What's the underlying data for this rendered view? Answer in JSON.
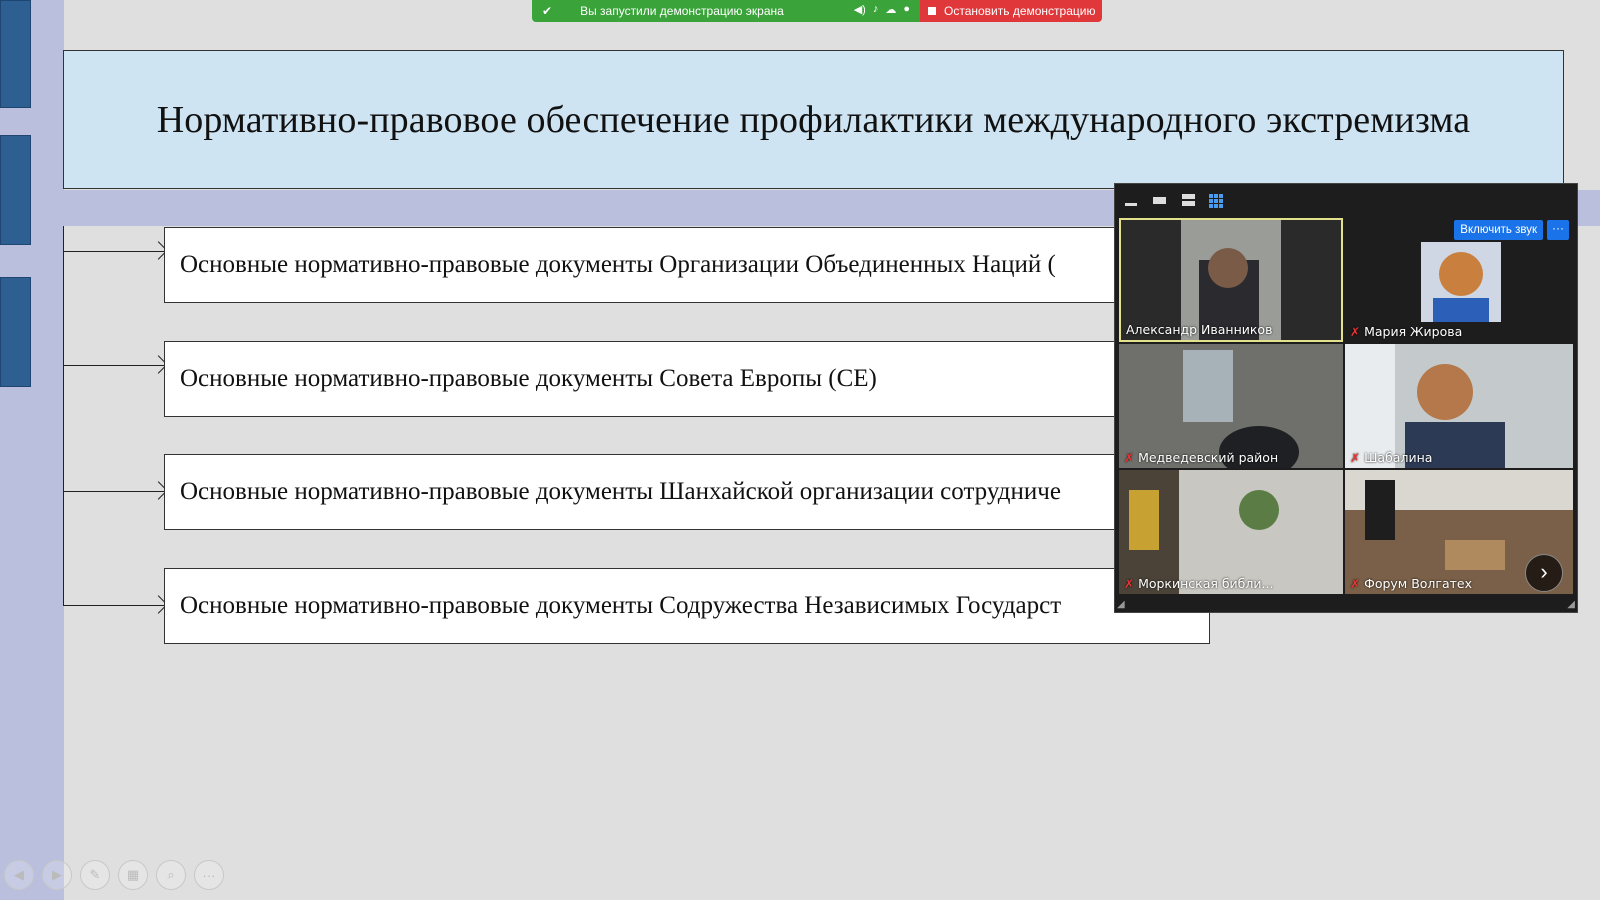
{
  "share_banner": {
    "status_text": "Вы запустили демонстрацию экрана",
    "stop_label": "Остановить демонстрацию"
  },
  "slide": {
    "title": "Нормативно-правовое обеспечение профилактики международного экстремизма",
    "items": [
      "Основные нормативно-правовые документы Организации Объединенных Наций (",
      "Основные нормативно-правовые документы Совета Европы (СЕ)",
      "Основные нормативно-правовые документы Шанхайской организации сотрудниче",
      "Основные нормативно-правовые документы Содружества Независимых Государст"
    ]
  },
  "video_panel": {
    "unmute_label": "Включить звук",
    "more_label": "···",
    "participants": [
      {
        "name": "Александр Иванников",
        "muted": false,
        "active": true
      },
      {
        "name": "Мария Жирова",
        "muted": true,
        "active": false
      },
      {
        "name": "Медведевский район",
        "muted": true,
        "active": false
      },
      {
        "name": "Шабалина",
        "muted": true,
        "active": false
      },
      {
        "name": "Моркинская библи...",
        "muted": true,
        "active": false
      },
      {
        "name": "Форум Волгатех",
        "muted": true,
        "active": false
      }
    ],
    "next_label": "›"
  },
  "slide_nav": {
    "buttons": [
      "previous-slide",
      "next-slide",
      "pen",
      "slides-overview",
      "zoom",
      "more-options"
    ]
  }
}
